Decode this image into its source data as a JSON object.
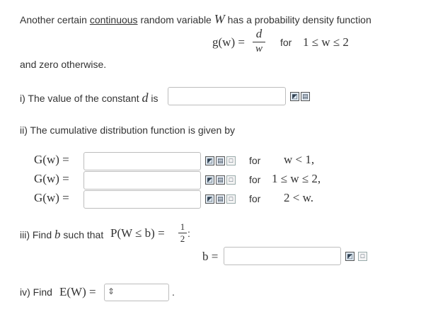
{
  "intro": {
    "text_before": "Another certain ",
    "link_text": "continuous",
    "text_after": " random variable ",
    "variable": "W",
    "text_end": " has a probability density function"
  },
  "pdf": {
    "lhs": "g(w) =",
    "numerator": "d",
    "denominator": "w",
    "for_label": "for",
    "condition": "1 ≤ w ≤ 2"
  },
  "zero_otherwise": "and zero otherwise.",
  "part1": {
    "label": "i) The value of the constant ",
    "var": "d",
    "suffix": " is",
    "value": ""
  },
  "part2": {
    "label": "ii) The cumulative distribution function is given by",
    "rows": [
      {
        "lhs": "G(w) =",
        "value": "",
        "for_label": "for",
        "condition": "w < 1,"
      },
      {
        "lhs": "G(w) =",
        "value": "",
        "for_label": "for",
        "condition": "1 ≤ w ≤ 2,"
      },
      {
        "lhs": "G(w) =",
        "value": "",
        "for_label": "for",
        "condition": "2 < w."
      }
    ]
  },
  "part3": {
    "label": "iii) Find ",
    "var": "b",
    "mid": " such that ",
    "expr": "P(W ≤ b) =",
    "frac_num": "1",
    "frac_den": "2",
    "end": ":",
    "b_label": "b =",
    "value": ""
  },
  "part4": {
    "label": "iv) Find ",
    "expr": "E(W) =",
    "value": "",
    "end": "."
  },
  "icons": {
    "preview": "preview-icon",
    "formula": "formula-editor-icon",
    "help": "help-icon",
    "select_arrows": "updown-arrows-icon"
  }
}
